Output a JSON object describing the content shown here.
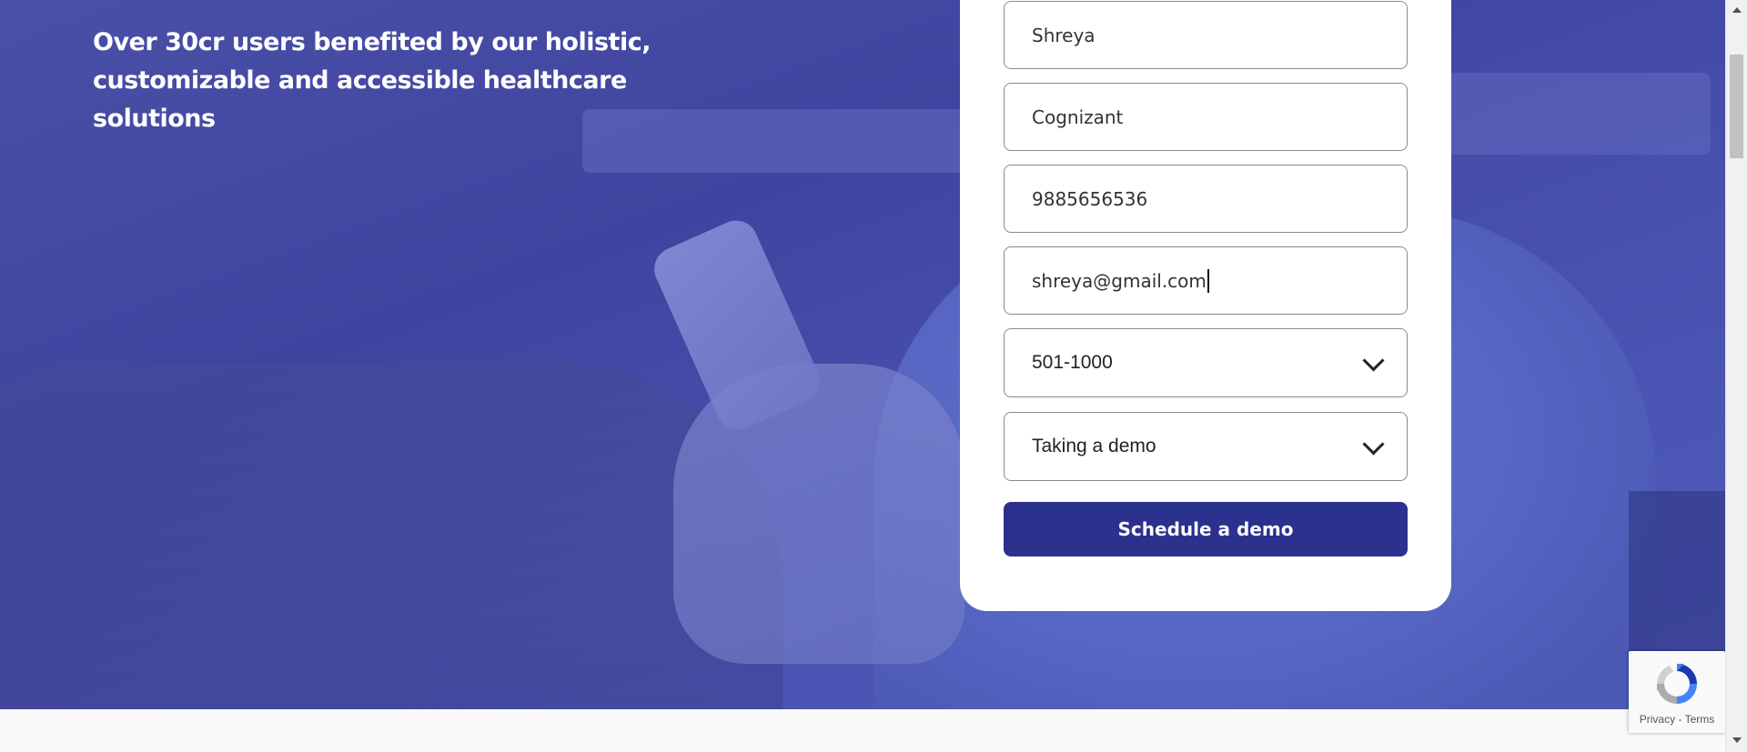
{
  "hero": {
    "headline_line1": "Over 30cr users benefited by our holistic,",
    "headline_line2": "customizable and accessible healthcare solutions"
  },
  "form": {
    "name_value": "Shreya",
    "company_value": "Cognizant",
    "phone_value": "9885656536",
    "email_value": "shreya@gmail.com",
    "employees_selected": "501-1000",
    "purpose_selected": "Taking a demo",
    "submit_label": "Schedule a demo"
  },
  "recaptcha": {
    "privacy_label": "Privacy",
    "separator": " - ",
    "terms_label": "Terms"
  },
  "colors": {
    "hero_overlay": "#3f44a0",
    "button_bg": "#2b318c",
    "card_bg": "#ffffff",
    "footer_bg": "#fafafa"
  },
  "icons": {
    "select_arrow": "chevron-down-icon",
    "recaptcha": "recaptcha-logo-icon"
  }
}
